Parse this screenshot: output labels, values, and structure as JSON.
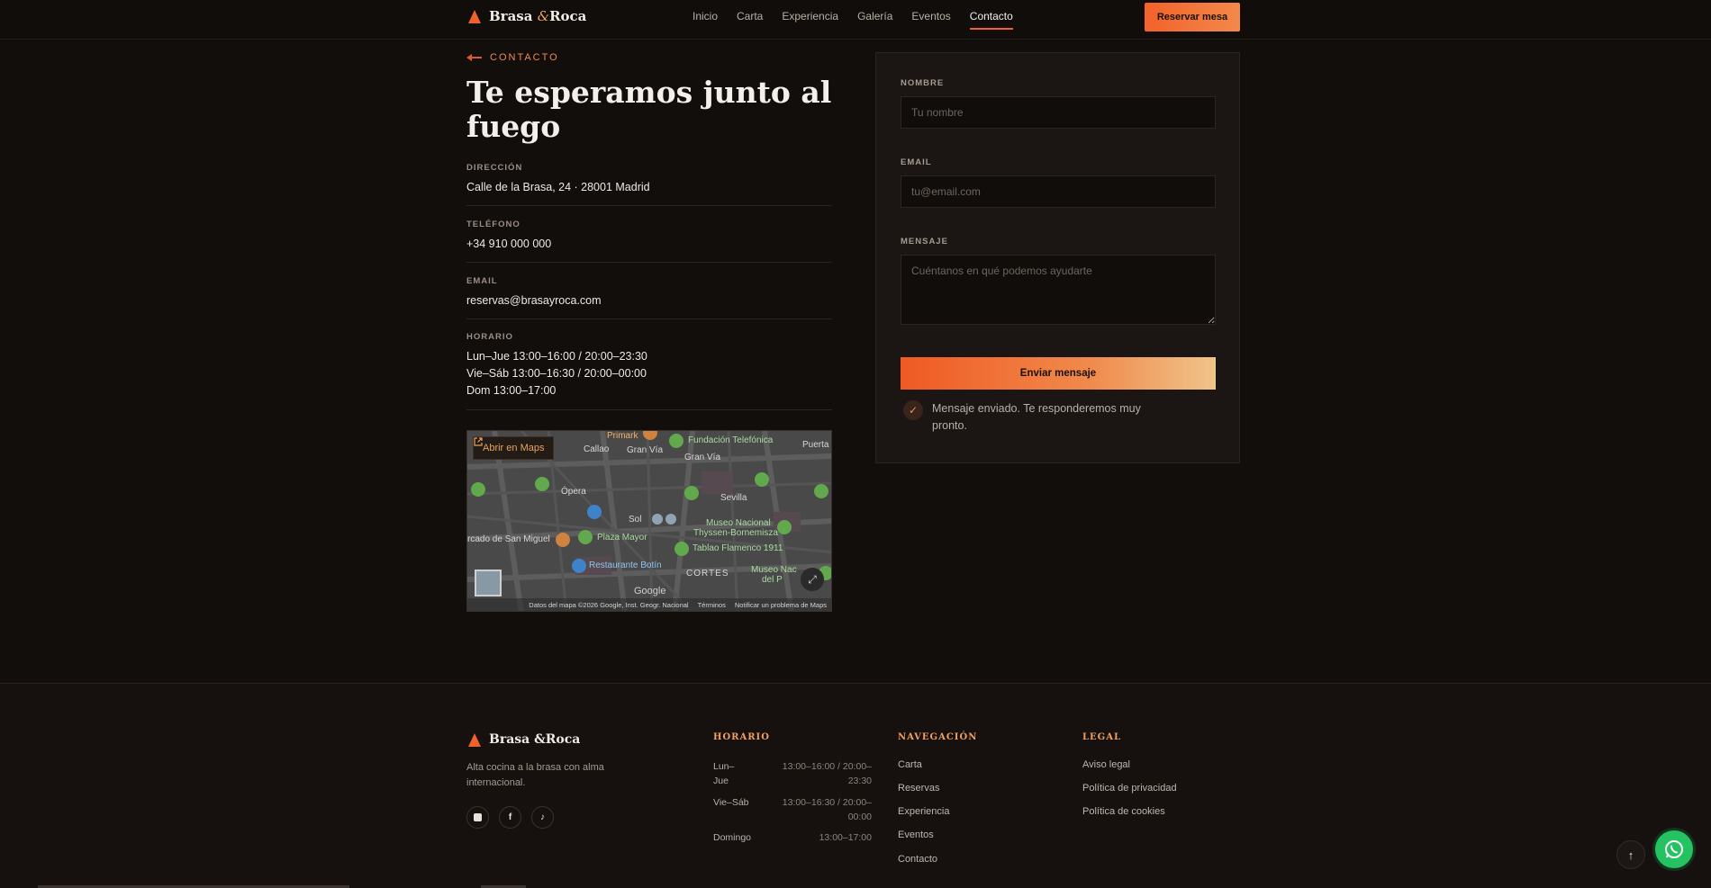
{
  "brand": {
    "name_part1": "Brasa",
    "amp": "&",
    "name_part2": "Roca"
  },
  "nav": {
    "items": [
      "Inicio",
      "Carta",
      "Experiencia",
      "Galería",
      "Eventos",
      "Contacto"
    ],
    "active": "Contacto",
    "reserve_label": "Reservar mesa"
  },
  "contact": {
    "eyebrow": "CONTACTO",
    "headline": "Te esperamos junto al fuego",
    "address_label": "DIRECCIÓN",
    "address": "Calle de la Brasa, 24 · 28001 Madrid",
    "phone_label": "TELÉFONO",
    "phone": "+34 910 000 000",
    "email_label": "EMAIL",
    "email": "reservas@brasayroca.com",
    "hours_label": "HORARIO",
    "hours": [
      "Lun–Jue 13:00–16:00 / 20:00–23:30",
      "Vie–Sáb 13:00–16:30 / 20:00–00:00",
      "Dom 13:00–17:00"
    ]
  },
  "map": {
    "open_label": "Abrir en Maps",
    "places": [
      "Primark",
      "Fundación Telefónica",
      "Puerta",
      "Callao",
      "Gran Vía",
      "Gran Vía",
      "Ópera",
      "Sevilla",
      "Sol",
      "Museo Nacional",
      "Thyssen-Bornemisza",
      "rcado de San Miguel",
      "Plaza Mayor",
      "Tablao Flamenco 1911",
      "Restaurante Botín",
      "CORTES",
      "Museo Nac",
      "del P"
    ],
    "google": "Google",
    "footer": [
      "Datos del mapa ©2026 Google, Inst. Geogr. Nacional",
      "Términos",
      "Notificar un problema de Maps"
    ]
  },
  "form": {
    "name_label": "NOMBRE",
    "name_placeholder": "Tu nombre",
    "email_label": "EMAIL",
    "email_placeholder": "tu@email.com",
    "message_label": "MENSAJE",
    "message_placeholder": "Cuéntanos en qué podemos ayudarte",
    "submit_label": "Enviar mensaje",
    "success": "Mensaje enviado. Te responderemos muy pronto."
  },
  "footer": {
    "tagline": "Alta cocina a la brasa con alma internacional.",
    "socials": [
      "instagram-icon",
      "facebook-icon",
      "tiktok-icon"
    ],
    "hours_title": "HORARIO",
    "hours": [
      {
        "day": "Lun–Jue",
        "time": "13:00–16:00 / 20:00–23:30"
      },
      {
        "day": "Vie–Sáb",
        "time": "13:00–16:30 / 20:00–00:00"
      },
      {
        "day": "Domingo",
        "time": "13:00–17:00"
      }
    ],
    "nav_title": "NAVEGACIÓN",
    "nav_links": [
      "Carta",
      "Reservas",
      "Experiencia",
      "Eventos",
      "Contacto"
    ],
    "legal_title": "LEGAL",
    "legal_links": [
      "Aviso legal",
      "Política de privacidad",
      "Política de cookies"
    ]
  },
  "colors": {
    "accent": "#f0622c",
    "gold": "#e8a35b",
    "background": "#120e0c",
    "whatsapp": "#25c262"
  }
}
